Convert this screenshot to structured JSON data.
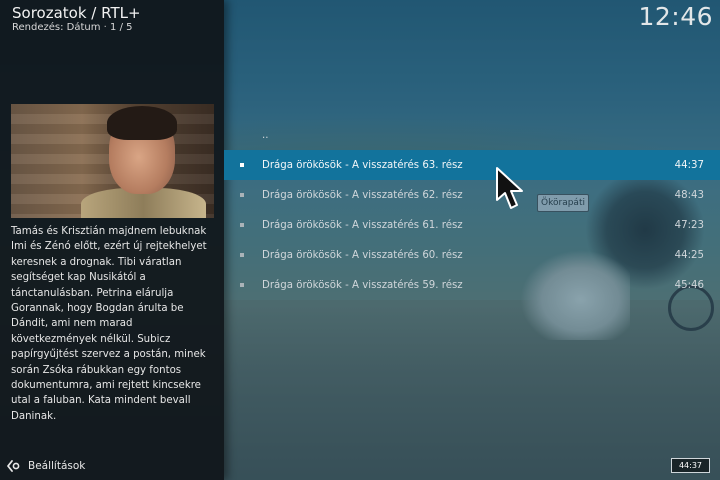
{
  "header": {
    "title": "Sorozatok / RTL+",
    "sort_label": "Rendezés: Dátum",
    "separator": "·",
    "page": "1 / 5"
  },
  "clock": "12:46",
  "info": {
    "plot": "Tamás és Krisztián majdnem lebuknak Imi és Zénó előtt, ezért új rejtekhelyet keresnek a drognak. Tibi váratlan segítséget kap Nusikától a tánctanulásban. Petrina elárulja Gorannak, hogy Bogdan árulta be Dándit, ami nem marad következmények nélkül. Subicz papírgyűjtést szervez a postán, minek során Zsóka rábukkan egy fontos dokumentumra, ami rejtett kincsekre utal a faluban. Kata mindent bevall Daninak."
  },
  "background": {
    "sign_text": "Ökörapáti"
  },
  "list": {
    "parent_label": "..",
    "items": [
      {
        "title": "Drága örökösök - A visszatérés 63. rész",
        "duration": "44:37",
        "selected": true
      },
      {
        "title": "Drága örökösök - A visszatérés 62. rész",
        "duration": "48:43",
        "selected": false
      },
      {
        "title": "Drága örökösök - A visszatérés 61. rész",
        "duration": "47:23",
        "selected": false
      },
      {
        "title": "Drága örökösök - A visszatérés 60. rész",
        "duration": "44:25",
        "selected": false
      },
      {
        "title": "Drága örökösök - A visszatérés 59. rész",
        "duration": "45:46",
        "selected": false
      }
    ]
  },
  "footer": {
    "settings_label": "Beállítások",
    "settings_icon": "settings-back-icon",
    "time_badge": "44:37"
  },
  "colors": {
    "selection": "#12739c",
    "panel": "#10161a"
  }
}
